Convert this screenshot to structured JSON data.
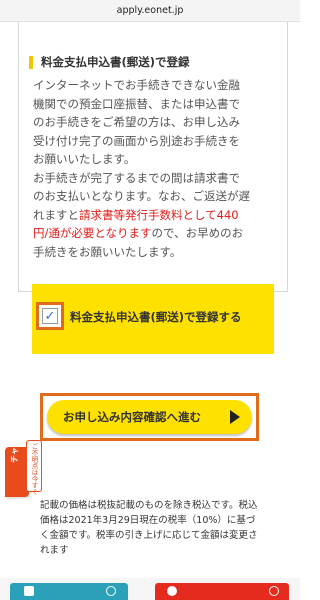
{
  "browser": {
    "url": "apply.eonet.jp"
  },
  "section": {
    "title": "料金支払申込書(郵送)で登録",
    "p1_line1": "インターネットでお手続きできない金融",
    "p1_line2": "機関での預金口座振替、または申込書で",
    "p1_line3": "のお手続きをご希望の方は、お申し込み",
    "p1_line4": "受け付け完了の画面から別途お手続きを",
    "p1_line5": "お願いいたします。",
    "p2_line1": "お手続きが完了するまでの間は請求書で",
    "p2_line2": "のお支払いとなります。なお、ご返送が遅",
    "p2_line3_a": "れますと",
    "p2_line3_red": "請求書等発行手数料として440",
    "p2_line4_red": "円/通が必要となります",
    "p2_line4_b": "ので、お早めのお",
    "p2_line5": "手続きをお願いいたします。"
  },
  "checkbox": {
    "checked_mark": "✓",
    "label": "料金支払申込書(郵送)で登録する",
    "checked": true
  },
  "proceed": {
    "label": "お申し込み内容確認へ進む"
  },
  "chat": {
    "label": "チャットへ",
    "tab_label": "ご不明点は今すぐ"
  },
  "note": {
    "line1": "記載の価格は税抜記載のものを除き税込です。税込",
    "line2": "価格は2021年3月29日現在の税率（10%）に基づ",
    "line3": "く金額です。税率の引き上げに応じて金額は変更さ",
    "line4": "れます"
  },
  "colors": {
    "accent_yellow": "#ffe100",
    "highlight_orange": "#e06b1a",
    "red_text": "#e0201c",
    "chat_orange": "#e84c1c",
    "teal": "#2aa1b9",
    "red_button": "#e52a1e"
  }
}
